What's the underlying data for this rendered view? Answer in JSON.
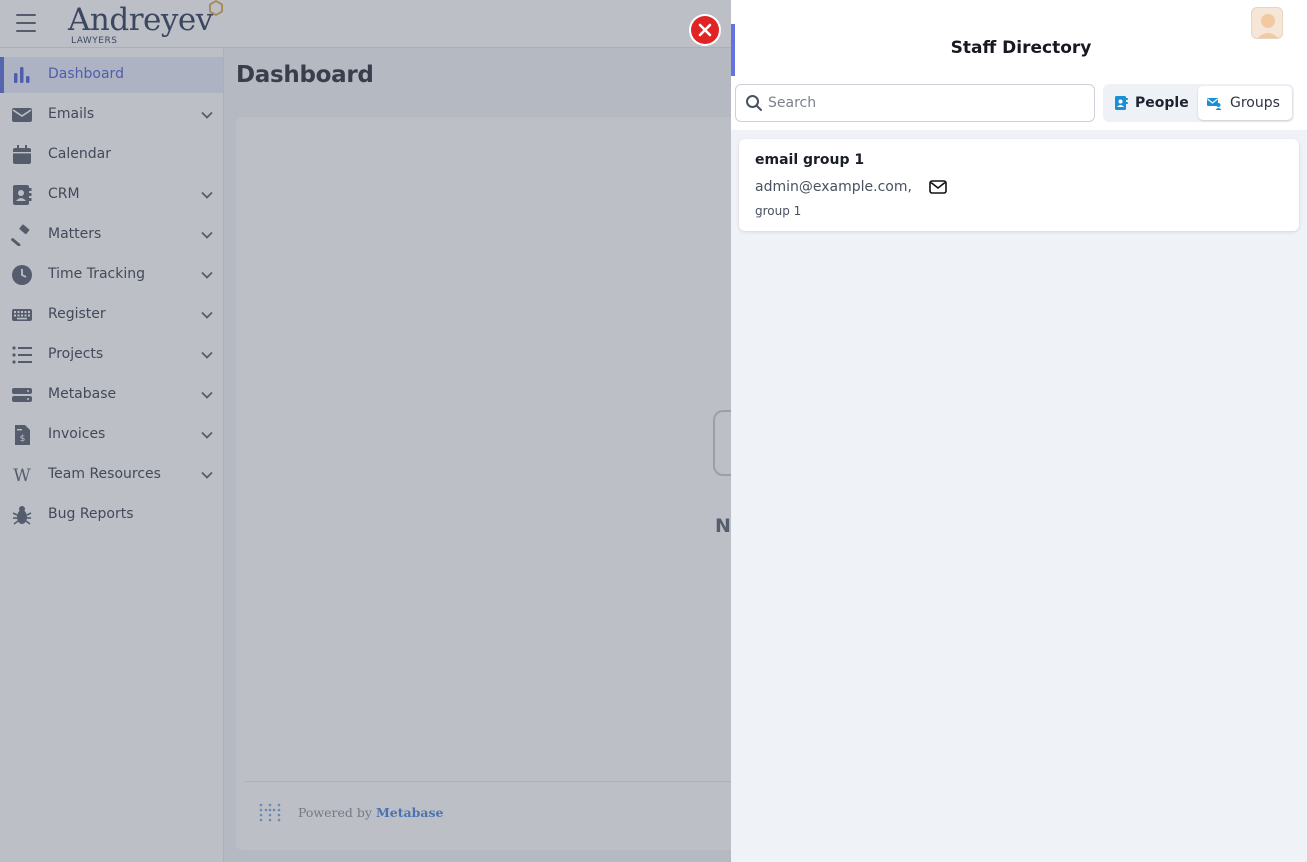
{
  "logo": {
    "name": "Andreyev",
    "sub": "LAWYERS"
  },
  "sidebar": {
    "items": [
      {
        "label": "Dashboard",
        "icon": "bar-chart-icon",
        "has_children": false,
        "active": true
      },
      {
        "label": "Emails",
        "icon": "envelope-icon",
        "has_children": true
      },
      {
        "label": "Calendar",
        "icon": "calendar-icon",
        "has_children": false
      },
      {
        "label": "CRM",
        "icon": "contact-book-icon",
        "has_children": true
      },
      {
        "label": "Matters",
        "icon": "gavel-icon",
        "has_children": true
      },
      {
        "label": "Time Tracking",
        "icon": "clock-icon",
        "has_children": true
      },
      {
        "label": "Register",
        "icon": "keyboard-icon",
        "has_children": true
      },
      {
        "label": "Projects",
        "icon": "list-icon",
        "has_children": true
      },
      {
        "label": "Metabase",
        "icon": "server-icon",
        "has_children": true
      },
      {
        "label": "Invoices",
        "icon": "invoice-icon",
        "has_children": true
      },
      {
        "label": "Team Resources",
        "icon": "wikipedia-icon",
        "has_children": true
      },
      {
        "label": "Bug Reports",
        "icon": "bug-icon",
        "has_children": false
      }
    ]
  },
  "main": {
    "title": "Dashboard",
    "footer": {
      "powered_prefix": "Powered by",
      "powered_brand": "Metabase"
    },
    "partial_text": "N"
  },
  "drawer": {
    "title": "Staff Directory",
    "search": {
      "placeholder": "Search",
      "value": ""
    },
    "toggle": {
      "people_label": "People",
      "groups_label": "Groups",
      "selected": "Groups"
    },
    "groups": [
      {
        "name": "email group 1",
        "email": "admin@example.com,",
        "description": "group 1"
      }
    ]
  },
  "colors": {
    "accent": "#5b6cd9",
    "close": "#e02424",
    "toggle_icon": "#1a8fd6"
  }
}
